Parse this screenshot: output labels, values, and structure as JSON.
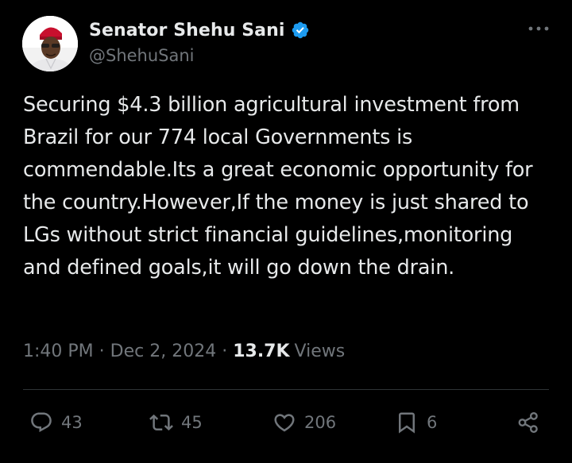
{
  "author": {
    "display_name": "Senator Shehu Sani",
    "handle": "@ShehuSani",
    "verified_color": "#1d9bf0"
  },
  "post": {
    "text": "Securing $4.3 billion agricultural investment from Brazil for our 774 local Governments is commendable.Its a great economic opportunity for the country.However,If the money is just shared to LGs without strict financial guidelines,monitoring and defined goals,it will go down the drain.",
    "time": "1:40 PM",
    "separator": "·",
    "date": "Dec 2, 2024",
    "views_count": "13.7K",
    "views_label": "Views"
  },
  "actions": {
    "replies": "43",
    "reposts": "45",
    "likes": "206",
    "bookmarks": "6"
  },
  "colors": {
    "background": "#000000",
    "primary_text": "#e7e9ea",
    "secondary_text": "#71767b",
    "divider": "#2f3336"
  }
}
